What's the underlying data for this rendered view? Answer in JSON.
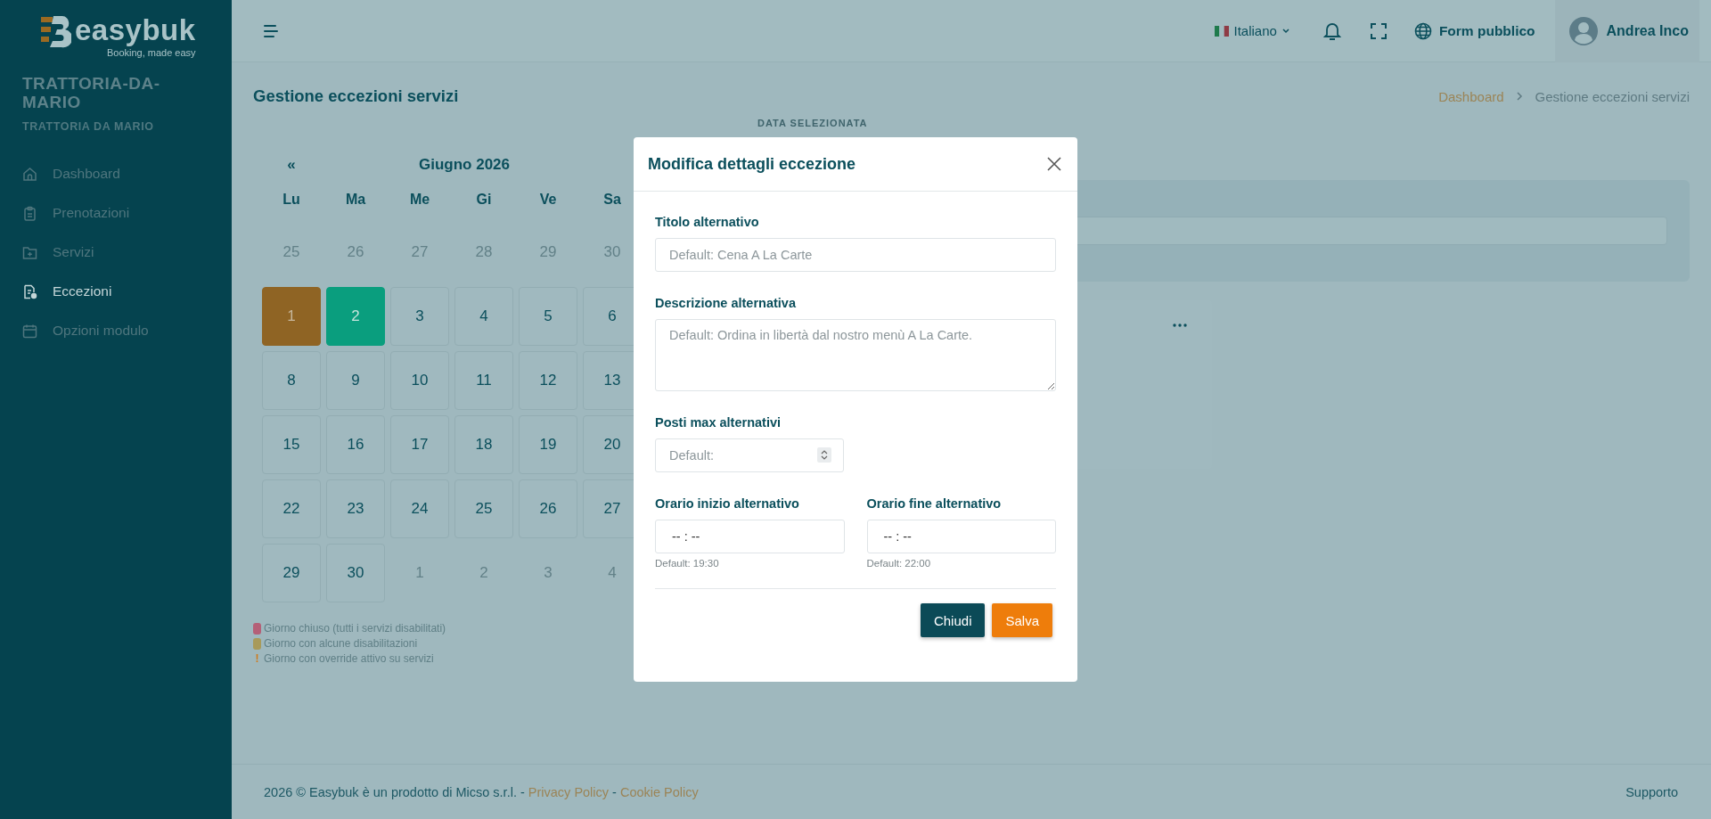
{
  "sidebar": {
    "logo": {
      "name": "easybuk",
      "tagline": "Booking, made easy"
    },
    "venue_slug": "TRATTORIA-DA-MARIO",
    "venue_name": "TRATTORIA DA MARIO",
    "items": [
      {
        "label": "Dashboard",
        "selected": false
      },
      {
        "label": "Prenotazioni",
        "selected": false
      },
      {
        "label": "Servizi",
        "selected": false
      },
      {
        "label": "Eccezioni",
        "selected": true
      },
      {
        "label": "Opzioni modulo",
        "selected": false
      }
    ]
  },
  "header": {
    "language": "Italiano",
    "public_form": "Form pubblico",
    "user": "Andrea Inco"
  },
  "page": {
    "title": "Gestione eccezioni servizi",
    "breadcrumb": [
      {
        "label": "Dashboard",
        "link": true
      },
      {
        "label": "Gestione eccezioni servizi",
        "link": false
      }
    ]
  },
  "calendar": {
    "prev": "«",
    "month": "Giugno 2026",
    "weekdays": [
      "Lu",
      "Ma",
      "Me",
      "Gi",
      "Ve",
      "Sa"
    ],
    "weeks": [
      [
        {
          "day": "25",
          "outside": true,
          "today": false,
          "selected": false
        },
        {
          "day": "26",
          "outside": true,
          "today": false,
          "selected": false
        },
        {
          "day": "27",
          "outside": true,
          "today": false,
          "selected": false
        },
        {
          "day": "28",
          "outside": true,
          "today": false,
          "selected": false
        },
        {
          "day": "29",
          "outside": true,
          "today": false,
          "selected": false
        },
        {
          "day": "30",
          "outside": true,
          "today": false,
          "selected": false
        }
      ],
      [
        {
          "day": "1",
          "outside": false,
          "today": true,
          "selected": false
        },
        {
          "day": "2",
          "outside": false,
          "today": false,
          "selected": true
        },
        {
          "day": "3",
          "outside": false,
          "today": false,
          "selected": false
        },
        {
          "day": "4",
          "outside": false,
          "today": false,
          "selected": false
        },
        {
          "day": "5",
          "outside": false,
          "today": false,
          "selected": false
        },
        {
          "day": "6",
          "outside": false,
          "today": false,
          "selected": false
        }
      ],
      [
        {
          "day": "8",
          "outside": false,
          "today": false,
          "selected": false
        },
        {
          "day": "9",
          "outside": false,
          "today": false,
          "selected": false
        },
        {
          "day": "10",
          "outside": false,
          "today": false,
          "selected": false
        },
        {
          "day": "11",
          "outside": false,
          "today": false,
          "selected": false
        },
        {
          "day": "12",
          "outside": false,
          "today": false,
          "selected": false
        },
        {
          "day": "13",
          "outside": false,
          "today": false,
          "selected": false
        }
      ],
      [
        {
          "day": "15",
          "outside": false,
          "today": false,
          "selected": false
        },
        {
          "day": "16",
          "outside": false,
          "today": false,
          "selected": false
        },
        {
          "day": "17",
          "outside": false,
          "today": false,
          "selected": false
        },
        {
          "day": "18",
          "outside": false,
          "today": false,
          "selected": false
        },
        {
          "day": "19",
          "outside": false,
          "today": false,
          "selected": false
        },
        {
          "day": "20",
          "outside": false,
          "today": false,
          "selected": false
        }
      ],
      [
        {
          "day": "22",
          "outside": false,
          "today": false,
          "selected": false
        },
        {
          "day": "23",
          "outside": false,
          "today": false,
          "selected": false
        },
        {
          "day": "24",
          "outside": false,
          "today": false,
          "selected": false
        },
        {
          "day": "25",
          "outside": false,
          "today": false,
          "selected": false
        },
        {
          "day": "26",
          "outside": false,
          "today": false,
          "selected": false
        },
        {
          "day": "27",
          "outside": false,
          "today": false,
          "selected": false
        }
      ],
      [
        {
          "day": "29",
          "outside": false,
          "today": false,
          "selected": false
        },
        {
          "day": "30",
          "outside": false,
          "today": false,
          "selected": false
        },
        {
          "day": "1",
          "outside": true,
          "today": false,
          "selected": false
        },
        {
          "day": "2",
          "outside": true,
          "today": false,
          "selected": false
        },
        {
          "day": "3",
          "outside": true,
          "today": false,
          "selected": false
        },
        {
          "day": "4",
          "outside": true,
          "today": false,
          "selected": false
        }
      ]
    ],
    "legend": [
      {
        "kind": "dot",
        "color": "#b46077",
        "label": "Giorno chiuso (tutti i servizi disabilitati)"
      },
      {
        "kind": "dot",
        "color": "#a89a5a",
        "label": "Giorno con alcune disabilitazioni"
      },
      {
        "kind": "mark",
        "mark": "!",
        "label": "Giorno con override attivo su servizi"
      }
    ]
  },
  "detail": {
    "caption": "DATA SELEZIONATA"
  },
  "modal": {
    "title": "Modifica dettagli eccezione",
    "fields": [
      {
        "kind": "text",
        "label": "Titolo alternativo",
        "placeholder": "Default: Cena A La Carte"
      },
      {
        "kind": "textarea",
        "label": "Descrizione alternativa",
        "placeholder": "Default: Ordina in libertà dal nostro menù A La Carte."
      },
      {
        "kind": "number",
        "label": "Posti max alternativi",
        "placeholder": "Default:"
      },
      {
        "kind": "time",
        "label": "Orario inizio alternativo",
        "placeholder": "-- : --",
        "hint": "Default: 19:30"
      },
      {
        "kind": "time",
        "label": "Orario fine alternativo",
        "placeholder": "-- : --",
        "hint": "Default: 22:00"
      }
    ],
    "buttons": [
      {
        "kind": "secondary",
        "label": "Chiudi"
      },
      {
        "kind": "primary",
        "label": "Salva"
      }
    ]
  },
  "footer": {
    "parts": [
      {
        "kind": "text",
        "text": "2026 © Easybuk è un prodotto di Micso s.r.l. - "
      },
      {
        "kind": "link",
        "text": "Privacy Policy"
      },
      {
        "kind": "text",
        "text": " - "
      },
      {
        "kind": "link",
        "text": "Cookie Policy"
      }
    ],
    "support": "Supporto"
  }
}
